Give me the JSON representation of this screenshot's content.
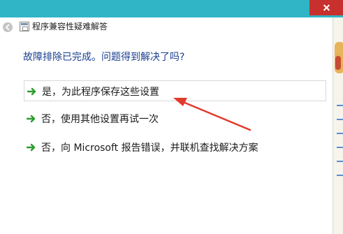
{
  "window": {
    "title": "程序兼容性疑难解答",
    "question": "故障排除已完成。问题得到解决了吗?"
  },
  "options": [
    {
      "label": "是，为此程序保存这些设置"
    },
    {
      "label": "否，使用其他设置再试一次"
    },
    {
      "label": "否，向 Microsoft 报告错误，并联机查找解决方案"
    }
  ],
  "icons": {
    "back": "back-arrow-icon",
    "app": "troubleshooter-icon",
    "option_arrow": "green-arrow-icon",
    "close": "close-icon"
  },
  "colors": {
    "titlebar": "#2fb5c6",
    "question_text": "#1a3f8f",
    "arrow_green": "#2c9c2c",
    "annotation_red": "#e2392b",
    "close_button": "#c7302c"
  }
}
